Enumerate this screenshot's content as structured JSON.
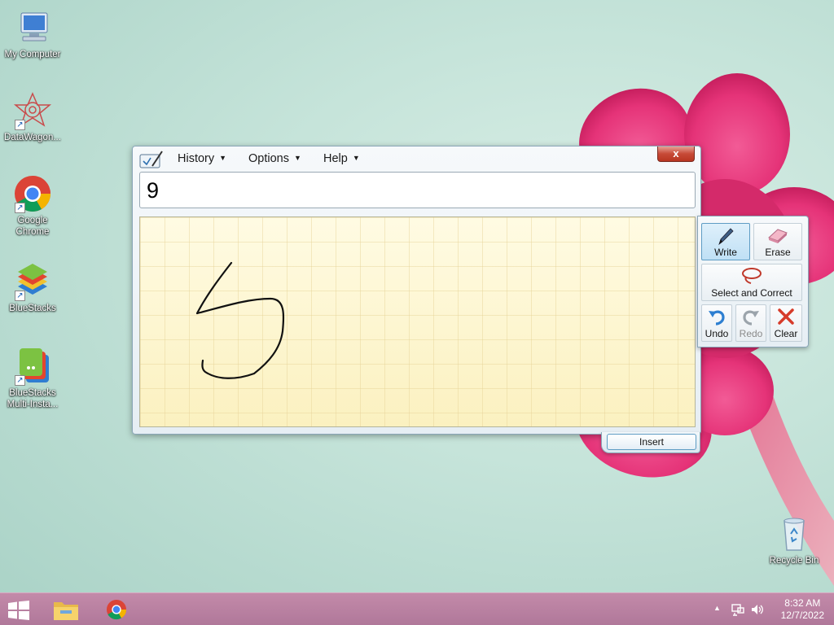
{
  "desktop": {
    "icons": [
      {
        "label": "My Computer",
        "icon": "computer-icon"
      },
      {
        "label": "DataWagon...",
        "icon": "datawagon-icon"
      },
      {
        "label": "Google Chrome",
        "icon": "chrome-icon"
      },
      {
        "label": "BlueStacks",
        "icon": "bluestacks-icon"
      },
      {
        "label": "BlueStacks Multi-Insta...",
        "icon": "bluestacks-multi-icon"
      },
      {
        "label": "Recycle Bin",
        "icon": "recycle-bin-icon"
      }
    ]
  },
  "tip": {
    "menu": {
      "history": "History",
      "options": "Options",
      "help": "Help"
    },
    "close_label": "x",
    "recognized_text": "9",
    "insert_label": "Insert",
    "tools": {
      "write": "Write",
      "erase": "Erase",
      "select": "Select and Correct",
      "undo": "Undo",
      "redo": "Redo",
      "clear": "Clear"
    }
  },
  "taskbar": {
    "apps": [
      "file-explorer-icon",
      "chrome-icon"
    ],
    "tray_caret": "▲",
    "time": "8:32 AM",
    "date": "12/7/2022"
  },
  "colors": {
    "accent": "#5e9cc4",
    "taskbar": "#b0789a",
    "pad": "#fdf8d4",
    "close": "#c74a37"
  }
}
